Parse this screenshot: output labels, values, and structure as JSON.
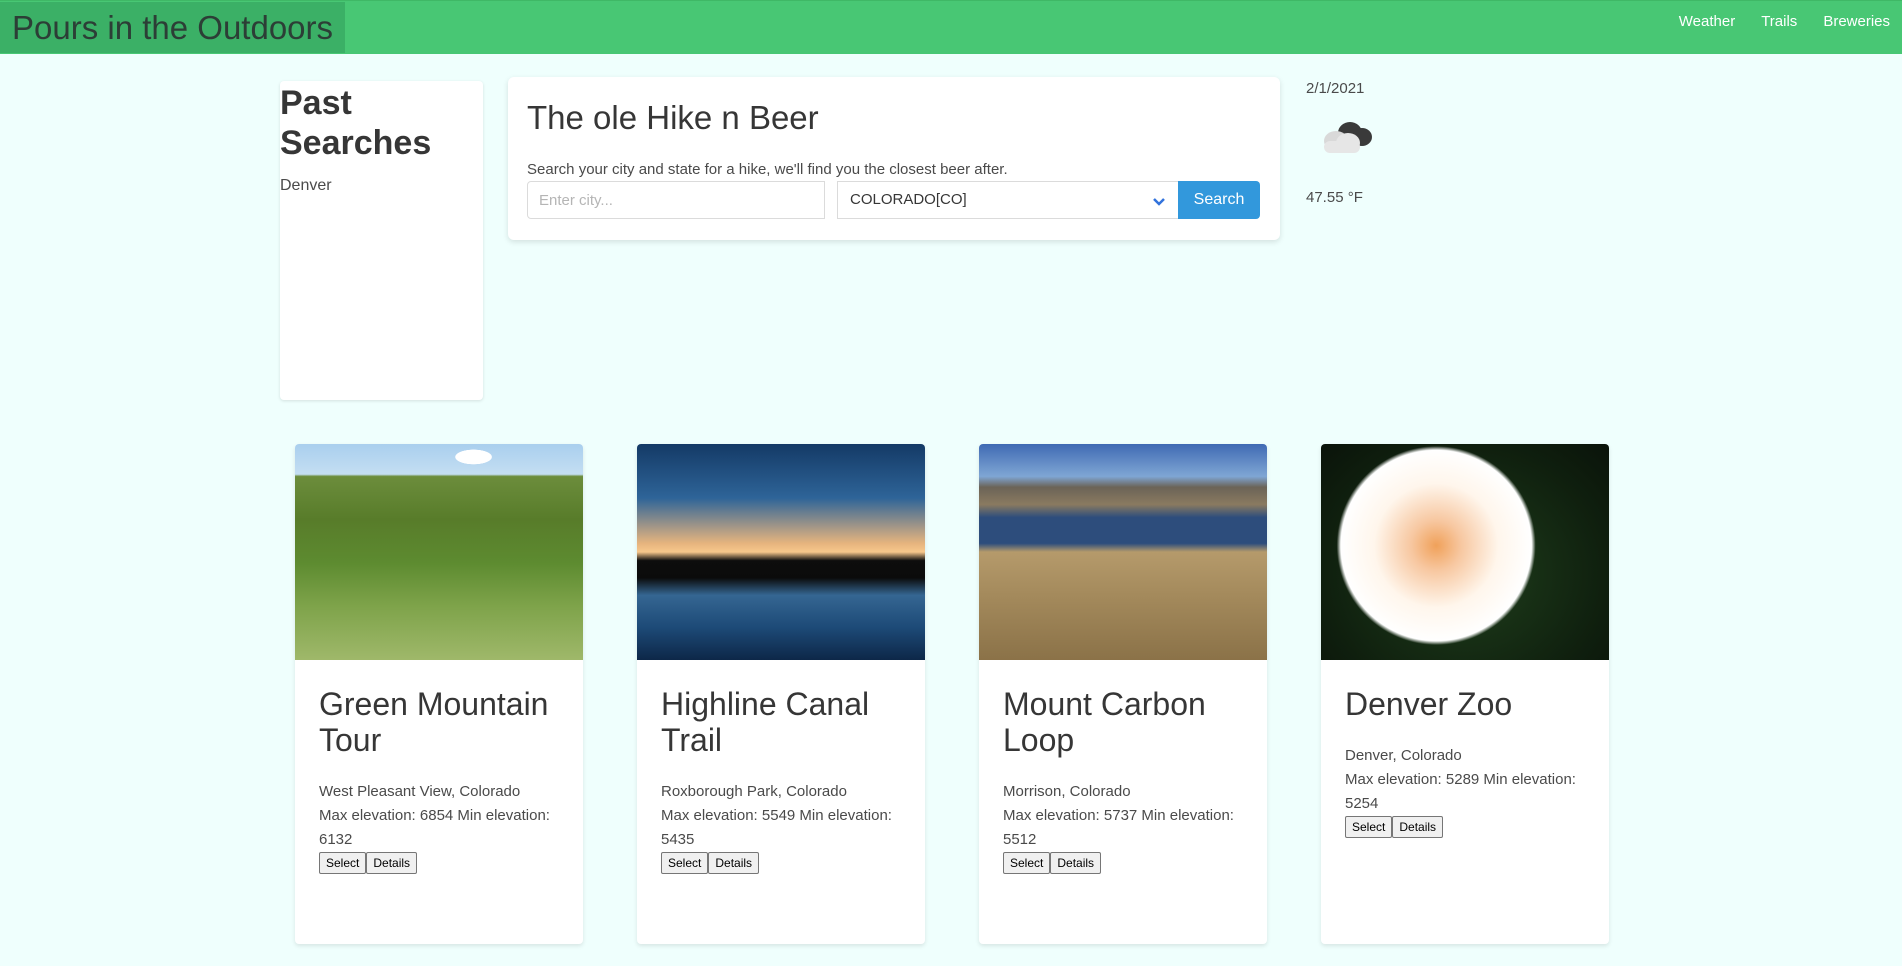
{
  "header": {
    "brand": "Pours in the Outdoors",
    "nav": [
      "Weather",
      "Trails",
      "Breweries"
    ],
    "bg_color": "#48c774"
  },
  "past_searches": {
    "title": "Past Searches",
    "items": [
      "Denver"
    ]
  },
  "search": {
    "title": "The ole Hike n Beer",
    "hint": "Search your city and state for a hike, we'll find you the closest beer after.",
    "city_placeholder": "Enter city...",
    "state_value": "COLORADO[CO]",
    "button_label": "Search",
    "button_color": "#3298dc"
  },
  "weather": {
    "date": "2/1/2021",
    "icon": "cloud-icon",
    "temp": "47.55 °F"
  },
  "trails": [
    {
      "name": "Green Mountain Tour",
      "location": "West Pleasant View, Colorado",
      "elevation": "Max elevation: 6854 Min elevation: 6132",
      "select_label": "Select",
      "details_label": "Details",
      "image": "meadow-photo"
    },
    {
      "name": "Highline Canal Trail",
      "location": "Roxborough Park, Colorado",
      "elevation": "Max elevation: 5549 Min elevation: 5435",
      "select_label": "Select",
      "details_label": "Details",
      "image": "sunset-lake-photo"
    },
    {
      "name": "Mount Carbon Loop",
      "location": "Morrison, Colorado",
      "elevation": "Max elevation: 5737 Min elevation: 5512",
      "select_label": "Select",
      "details_label": "Details",
      "image": "mountain-lake-trail-photo"
    },
    {
      "name": "Denver Zoo",
      "location": "Denver, Colorado",
      "elevation": "Max elevation: 5289 Min elevation: 5254",
      "select_label": "Select",
      "details_label": "Details",
      "image": "flower-photo"
    }
  ]
}
